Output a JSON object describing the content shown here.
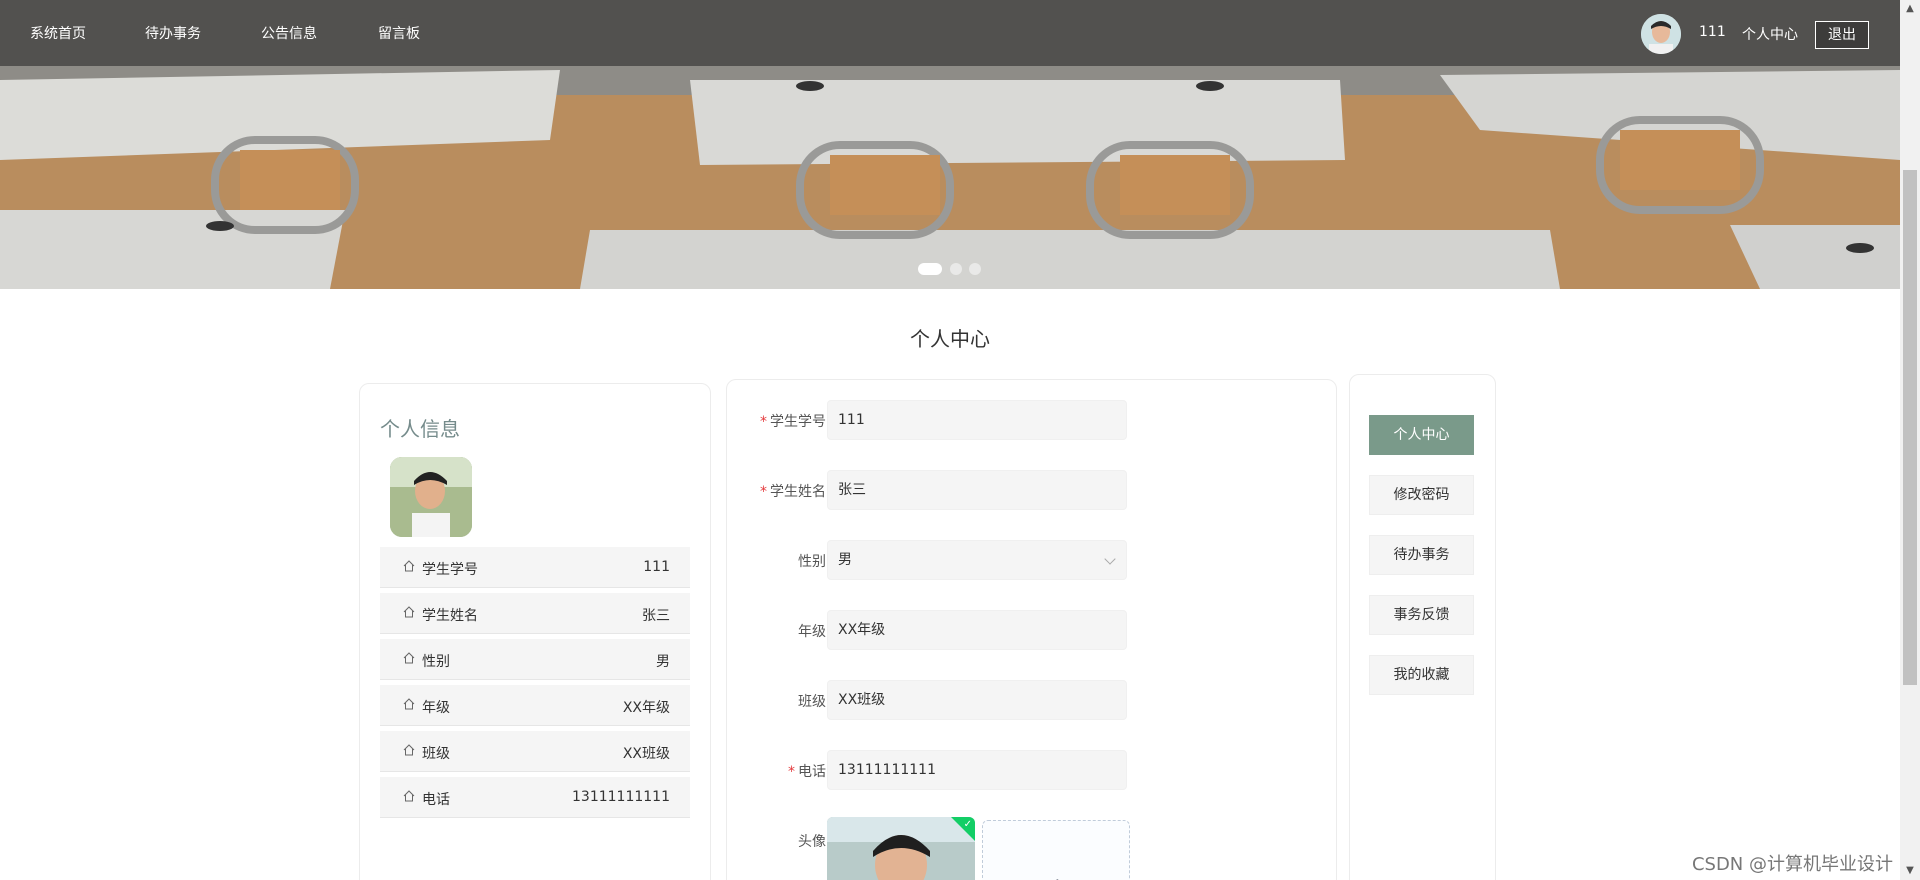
{
  "nav": {
    "items": [
      "系统首页",
      "待办事务",
      "公告信息",
      "留言板"
    ],
    "username": "111",
    "center_label": "个人中心",
    "logout_label": "退出"
  },
  "page_title": "个人中心",
  "profile": {
    "title": "个人信息",
    "rows": [
      {
        "label": "学生学号",
        "value": "111"
      },
      {
        "label": "学生姓名",
        "value": "张三"
      },
      {
        "label": "性别",
        "value": "男"
      },
      {
        "label": "年级",
        "value": "XX年级"
      },
      {
        "label": "班级",
        "value": "XX班级"
      },
      {
        "label": "电话",
        "value": "13111111111"
      }
    ]
  },
  "form": {
    "fields": [
      {
        "label": "学生学号",
        "value": "111",
        "required": true
      },
      {
        "label": "学生姓名",
        "value": "张三",
        "required": true
      },
      {
        "label": "性别",
        "value": "男",
        "required": false
      },
      {
        "label": "年级",
        "value": "XX年级",
        "required": false
      },
      {
        "label": "班级",
        "value": "XX班级",
        "required": false
      },
      {
        "label": "电话",
        "value": "13111111111",
        "required": true
      }
    ],
    "avatar_label": "头像",
    "required_mark": "*",
    "upload_plus": "+",
    "upload_check": "✓"
  },
  "side_menu": {
    "items": [
      "个人中心",
      "修改密码",
      "待办事务",
      "事务反馈",
      "我的收藏"
    ],
    "active_index": 0
  },
  "carousel": {
    "slide_count": 3,
    "active_slide": 0
  },
  "watermark": "CSDN @计算机毕业设计",
  "colors": {
    "accent": "#7a9a8a",
    "title_green": "#758b8b",
    "required": "#e4393c"
  }
}
